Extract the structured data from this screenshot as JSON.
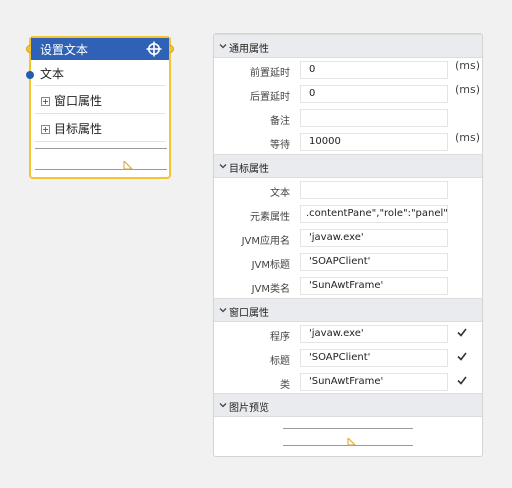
{
  "node": {
    "title": "设置文本",
    "text_port_label": "文本",
    "window_props_label": "窗口属性",
    "target_props_label": "目标属性",
    "header_color": "#2f62b6",
    "border_color": "#f3c330"
  },
  "panel": {
    "general": {
      "title": "通用属性",
      "pre_delay_label": "前置延时",
      "pre_delay_value": "0",
      "pre_delay_unit": "(ms)",
      "post_delay_label": "后置延时",
      "post_delay_value": "0",
      "post_delay_unit": "(ms)",
      "note_label": "备注",
      "note_value": "",
      "wait_label": "等待",
      "wait_value": "10000",
      "wait_unit": "(ms)"
    },
    "target": {
      "title": "目标属性",
      "text_label": "文本",
      "text_value": "",
      "element_label": "元素属性",
      "element_value": ".contentPane\",\"role\":\"panel\"}]",
      "jvm_app_label": "JVM应用名",
      "jvm_app_value": "'javaw.exe'",
      "jvm_title_label": "JVM标题",
      "jvm_title_value": "'SOAPClient'",
      "jvm_class_label": "JVM类名",
      "jvm_class_value": "'SunAwtFrame'"
    },
    "window": {
      "title": "窗口属性",
      "program_label": "程序",
      "program_value": "'javaw.exe'",
      "title_label": "标题",
      "title_value": "'SOAPClient'",
      "class_label": "类",
      "class_value": "'SunAwtFrame'"
    },
    "preview": {
      "title": "图片预览"
    }
  }
}
